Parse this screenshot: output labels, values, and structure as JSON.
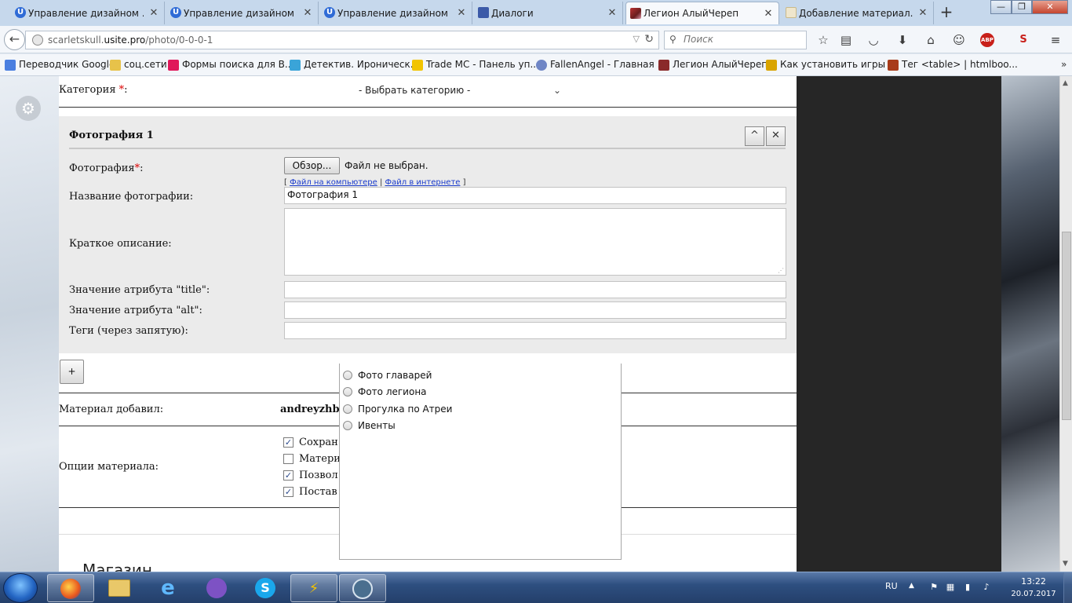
{
  "browser": {
    "tabs": [
      {
        "title": "Управление дизайном ...",
        "icon": "ucoz-icon"
      },
      {
        "title": "Управление дизайном ...",
        "icon": "ucoz-icon"
      },
      {
        "title": "Управление дизайном ...",
        "icon": "ucoz-icon"
      },
      {
        "title": "Диалоги",
        "icon": "dialog-icon"
      },
      {
        "title": "Легион АлыйЧереп",
        "icon": "site-thumb-icon"
      },
      {
        "title": "Добавление материал...",
        "icon": "page-icon"
      }
    ],
    "tab_close_glyph": "✕",
    "new_tab_glyph": "+",
    "window_controls": {
      "minimize": "—",
      "restore": "❐",
      "close": "✕"
    },
    "url_prefix": "scarletskull.",
    "url_domain": "usite.pro",
    "url_path": "/photo/0-0-0-1",
    "search_placeholder": "Поиск",
    "abp_label": "ABP",
    "bookmarks": [
      "Переводчик Google",
      "соц.сети",
      "Формы поиска для В...",
      "Детектив. Ироническ...",
      "Trade MC - Панель уп...",
      "FallenAngel - Главная ...",
      "Легион АлыйЧереп",
      "Как установить игры ...",
      "Тег <table> | htmlboo..."
    ]
  },
  "form": {
    "category_label": "Категория ",
    "category_required": "*",
    "category_suffix": ":",
    "category_select_value": "- Выбрать категорию -",
    "photo_block_title": "Фотография 1",
    "collapse_glyph": "^",
    "remove_glyph": "✕",
    "photo_label": "Фотография",
    "photo_required": "*",
    "photo_suffix": ":",
    "browse_button": "Обзор...",
    "file_status": "Файл не выбран.",
    "file_links_open": "[ ",
    "file_link_computer": "Файл на компьютере",
    "file_links_sep": " | ",
    "file_link_internet": "Файл в интернете",
    "file_links_close": " ]",
    "photo_name_label": "Название фотографии:",
    "photo_name_value": "Фотография 1",
    "short_desc_label": "Краткое описание:",
    "title_attr_label": "Значение атрибута \"title\":",
    "alt_attr_label": "Значение атрибута \"alt\":",
    "tags_label": "Теги (через запятую):",
    "add_photo_button": "+",
    "added_by_label": "Материал добавил:",
    "added_by_value": "andreyzhba",
    "options_label": "Опции материала:",
    "options": [
      {
        "label": "Сохран",
        "checked": true
      },
      {
        "label": "Матери",
        "checked": false
      },
      {
        "label": "Позвол",
        "checked": true
      },
      {
        "label": "Постав",
        "checked": true
      }
    ],
    "check_glyph": "✓",
    "shop_heading": "Магазин"
  },
  "category_dropdown": {
    "options": [
      "Фото главарей",
      "Фото легиона",
      "Прогулка по Атреи",
      "Ивенты"
    ]
  },
  "taskbar": {
    "language": "RU",
    "time": "13:22",
    "date": "20.07.2017"
  },
  "colors": {
    "required": "#dd0000",
    "link": "#1a3bcc",
    "taskbar": "#2e4f80"
  }
}
